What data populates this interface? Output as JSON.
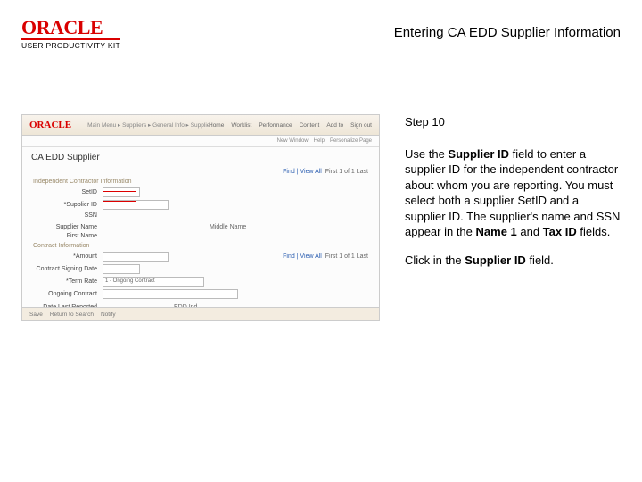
{
  "header": {
    "brand_main": "ORACLE",
    "brand_sub": "USER PRODUCTIVITY KIT",
    "page_title": "Entering CA EDD Supplier Information"
  },
  "screenshot": {
    "brand": "ORACLE",
    "crumbs": "Main Menu ▸ Suppliers ▸ General Info ▸ Supplier Information",
    "top_tabs": [
      "Home",
      "Worklist",
      "Performance",
      "Content",
      "Add to",
      "Sign out"
    ],
    "subbar": [
      "New Window",
      "Help",
      "Personalize Page"
    ],
    "big_title": "CA EDD Supplier",
    "section_indep": "Independent Contractor Information",
    "section_contract": "Contract Information",
    "labels": {
      "setid": "SetID",
      "supplier_id": "*Supplier ID",
      "ssn": "SSN",
      "supplier_name": "Supplier Name",
      "first_name": "First Name",
      "middle_name": "Middle Name",
      "amount": "*Amount",
      "contract_sd": "Contract Signing Date",
      "term_rate": "*Term Rate",
      "ongoing": "Ongoing Contract",
      "date_last": "Date Last Reported",
      "edd_ind": "EDD Ind"
    },
    "supplier_id_value": "",
    "find_view": "Find | View All",
    "first_last": "First  1 of 1  Last",
    "term_rate_value": "1 - Ongoing Contract",
    "footer": [
      "Save",
      "Return to Search",
      "Notify"
    ]
  },
  "instructions": {
    "step_label": "Step 10",
    "p1_a": "Use the ",
    "p1_b": "Supplier ID",
    "p1_c": " field to enter a supplier ID for the independent contractor about whom you are reporting. You must select both a supplier SetID and a supplier ID. The supplier's name and SSN appear in the ",
    "p1_d": "Name 1",
    "p1_e": " and ",
    "p1_f": "Tax ID",
    "p1_g": " fields.",
    "p2_a": "Click in the ",
    "p2_b": "Supplier ID",
    "p2_c": " field."
  }
}
